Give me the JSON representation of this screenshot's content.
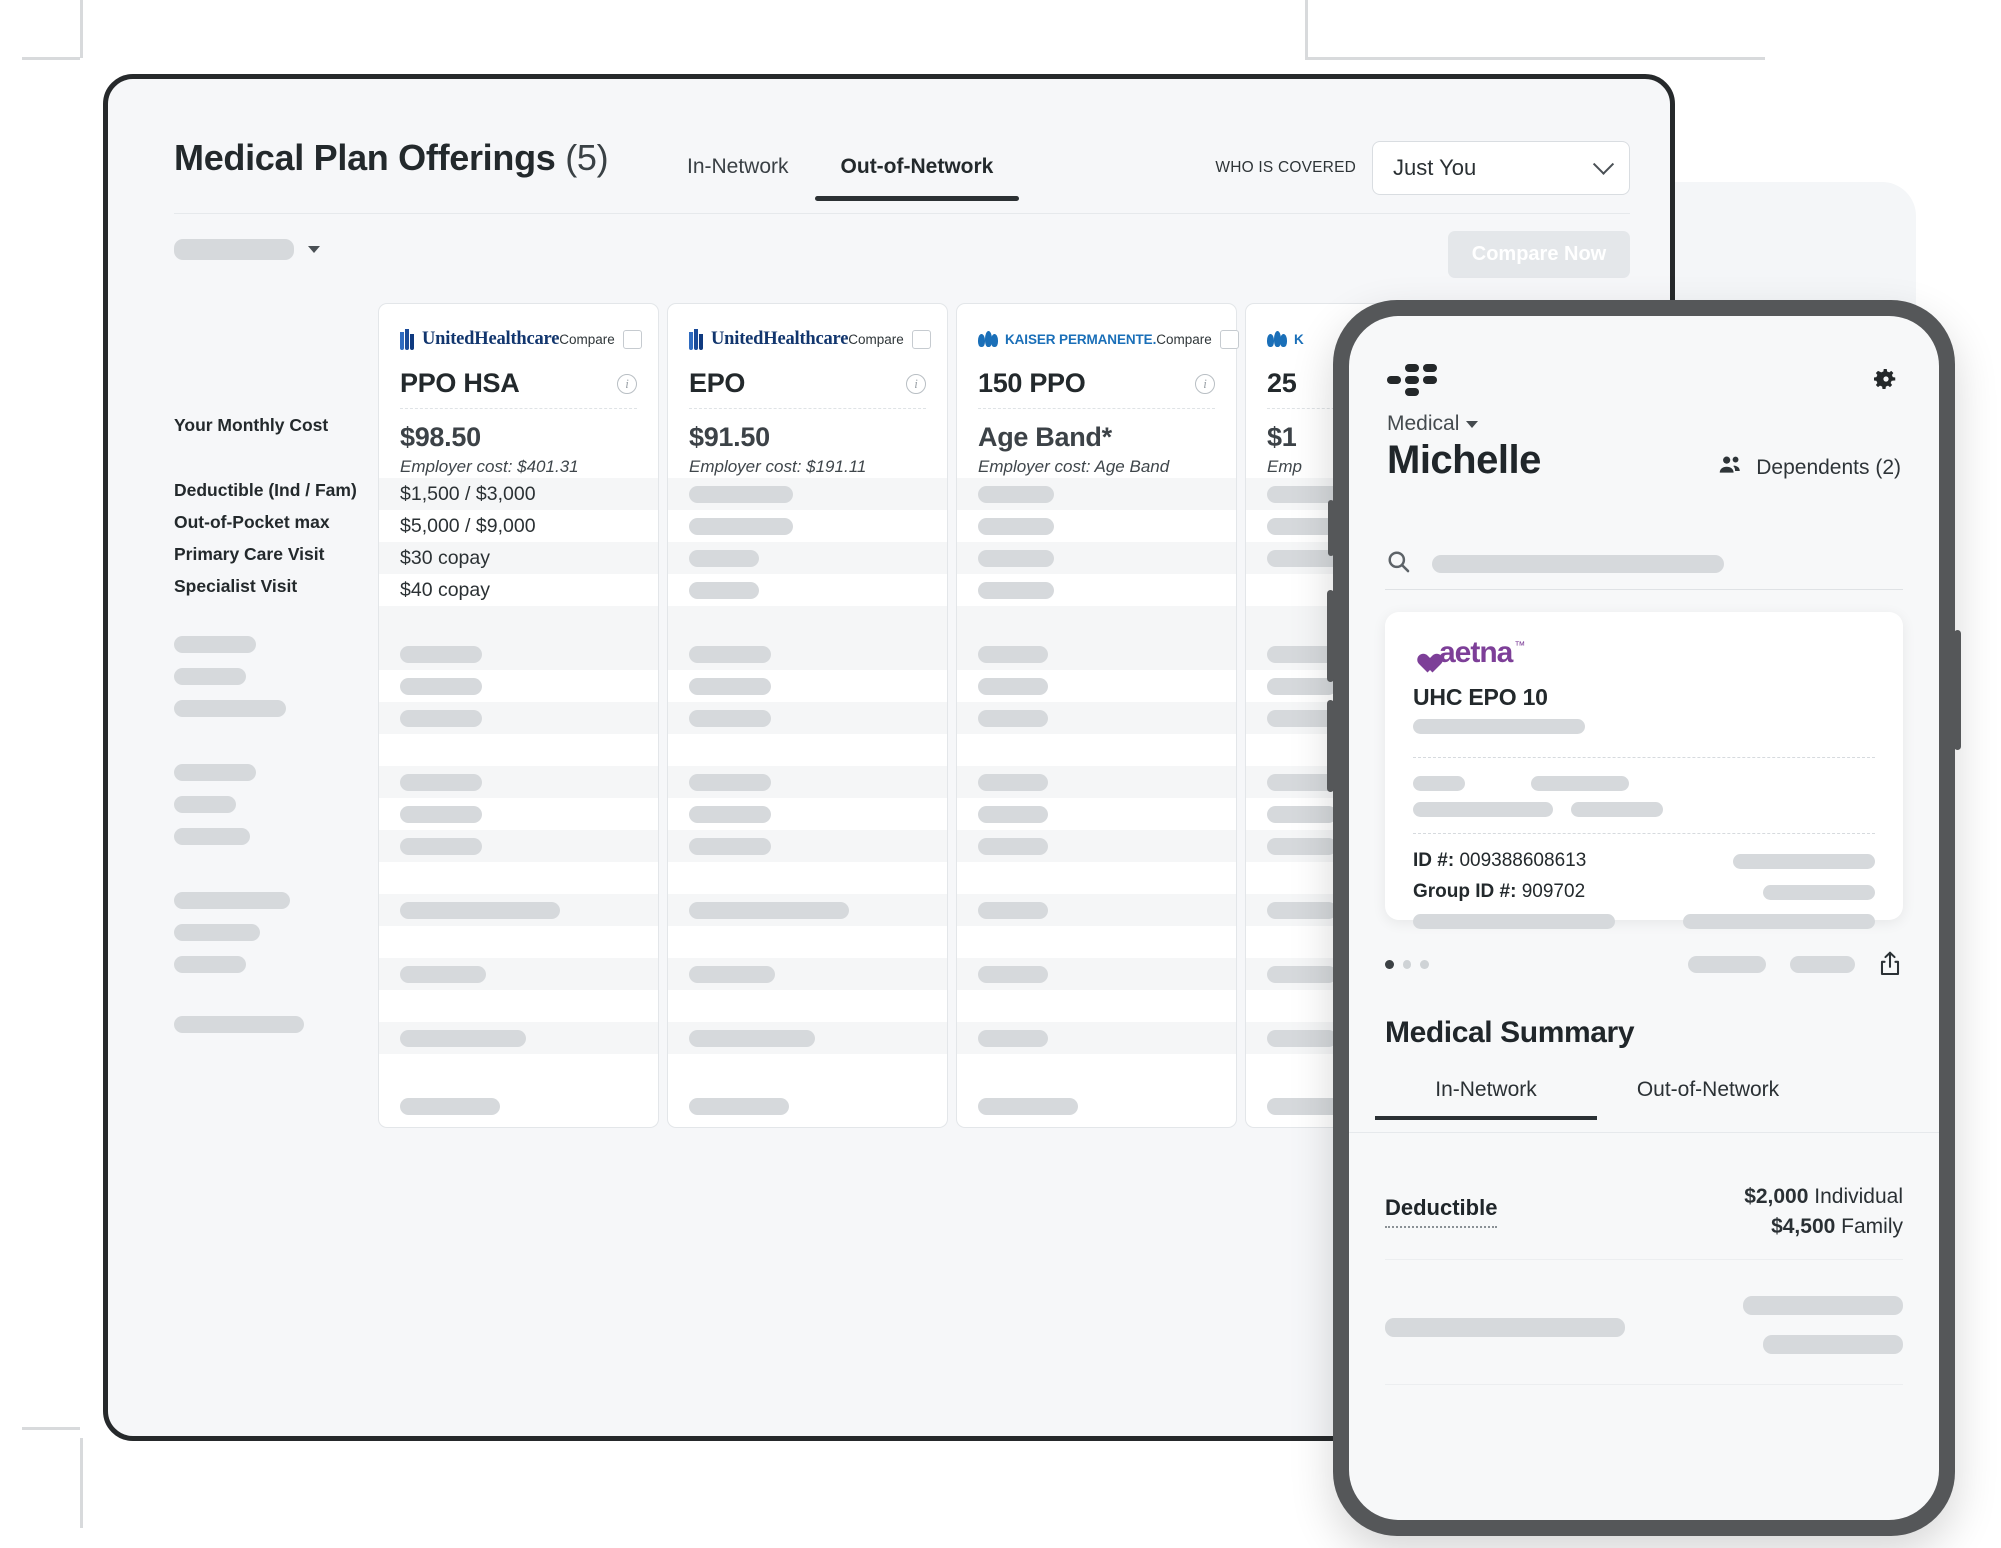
{
  "desktop": {
    "header": {
      "title": "Medical Plan Offerings",
      "count": "(5)",
      "tabs": [
        {
          "label": "In-Network",
          "active": false
        },
        {
          "label": "Out-of-Network",
          "active": true
        }
      ],
      "who_is_covered_label": "WHO IS COVERED",
      "who_is_covered_value": "Just You"
    },
    "toolbar": {
      "compare_now_label": "Compare Now",
      "compare_now_disabled": true
    },
    "table": {
      "row_labels": [
        "Your Monthly Cost",
        "Deductible (Ind / Fam)",
        "Out-of-Pocket max",
        "Primary Care Visit",
        "Specialist Visit"
      ],
      "compare_label": "Compare",
      "plans": [
        {
          "carrier": "UnitedHealthcare",
          "carrier_logo": "uhc-logo",
          "name": "PPO HSA",
          "price": "$98.50",
          "employer_cost": "Employer cost: $401.31",
          "values": [
            "$1,500 / $3,000",
            "$5,000 / $9,000",
            "$30 copay",
            "$40 copay"
          ]
        },
        {
          "carrier": "UnitedHealthcare",
          "carrier_logo": "uhc-logo",
          "name": "EPO",
          "price": "$91.50",
          "employer_cost": "Employer cost: $191.11",
          "values": [
            "",
            "",
            "",
            ""
          ]
        },
        {
          "carrier": "KAISER PERMANENTE.",
          "carrier_logo": "kaiser-logo",
          "name": "150 PPO",
          "price": "Age Band*",
          "employer_cost": "Employer cost: Age Band",
          "values": [
            "",
            "",
            "",
            ""
          ]
        },
        {
          "carrier": "K",
          "carrier_logo": "kaiser-logo",
          "name": "25",
          "price": "$1",
          "employer_cost": "Emp",
          "values": [
            "",
            "",
            "",
            ""
          ]
        }
      ]
    }
  },
  "phone": {
    "logo": "app-logo-dots",
    "settings_icon": "gear-icon",
    "category": "Medical",
    "member_name": "Michelle",
    "dependents_label": "Dependents (2)",
    "dependents_icon": "people-icon",
    "search_icon": "search-icon",
    "search_placeholder": "",
    "id_card": {
      "carrier": "aetna",
      "carrier_tm": "™",
      "plan_name": "UHC EPO 10",
      "id_label": "ID #:",
      "id_value": "009388608613",
      "group_label": "Group ID #:",
      "group_value": "909702"
    },
    "carousel": {
      "dots": 3,
      "active_index": 0
    },
    "share_icon": "share-icon",
    "summary": {
      "title": "Medical Summary",
      "tabs": [
        {
          "label": "In-Network",
          "active": true
        },
        {
          "label": "Out-of-Network",
          "active": false
        }
      ],
      "rows": [
        {
          "label": "Deductible",
          "value_individual": "$2,000",
          "unit_individual": "Individual",
          "value_family": "$4,500",
          "unit_family": "Family"
        }
      ]
    }
  },
  "colors": {
    "frame": "#26292b",
    "phone_body": "#555759",
    "accent_uhc": "#1a4b99",
    "accent_kaiser": "#1a6fb8",
    "accent_aetna": "#7d3f98",
    "skeleton": "#d6d9dc"
  }
}
